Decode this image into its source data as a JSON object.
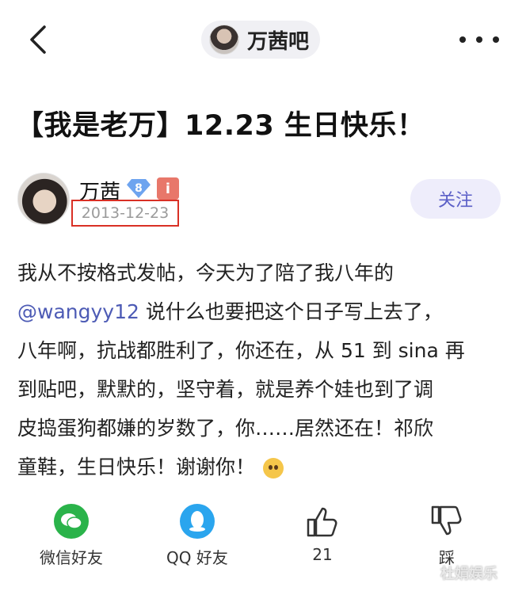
{
  "header": {
    "forum_name": "万茜吧"
  },
  "post": {
    "title": "【我是老万】12.23 生日快乐！",
    "author": {
      "name": "万茜",
      "level": "8",
      "info_badge": "i",
      "date": "2013-12-23"
    },
    "follow_label": "关注",
    "body": {
      "line1": "我从不按格式发帖，今天为了陪了我八年的",
      "mention": "@wangyy12",
      "line2_rest": " 说什么也要把这个日子写上去了，",
      "line3": "八年啊，抗战都胜利了，你还在，从 51 到 sina 再",
      "line4": "到贴吧，默默的，坚守着，就是养个娃也到了调",
      "line5": "皮捣蛋狗都嫌的岁数了，你……居然还在！祁欣",
      "line6": "童鞋，生日快乐！谢谢你！"
    }
  },
  "actions": {
    "wechat_label": "微信好友",
    "qq_label": "QQ 好友",
    "like_count": "21",
    "dislike_label": "踩"
  },
  "watermark": "杜娟娱乐"
}
